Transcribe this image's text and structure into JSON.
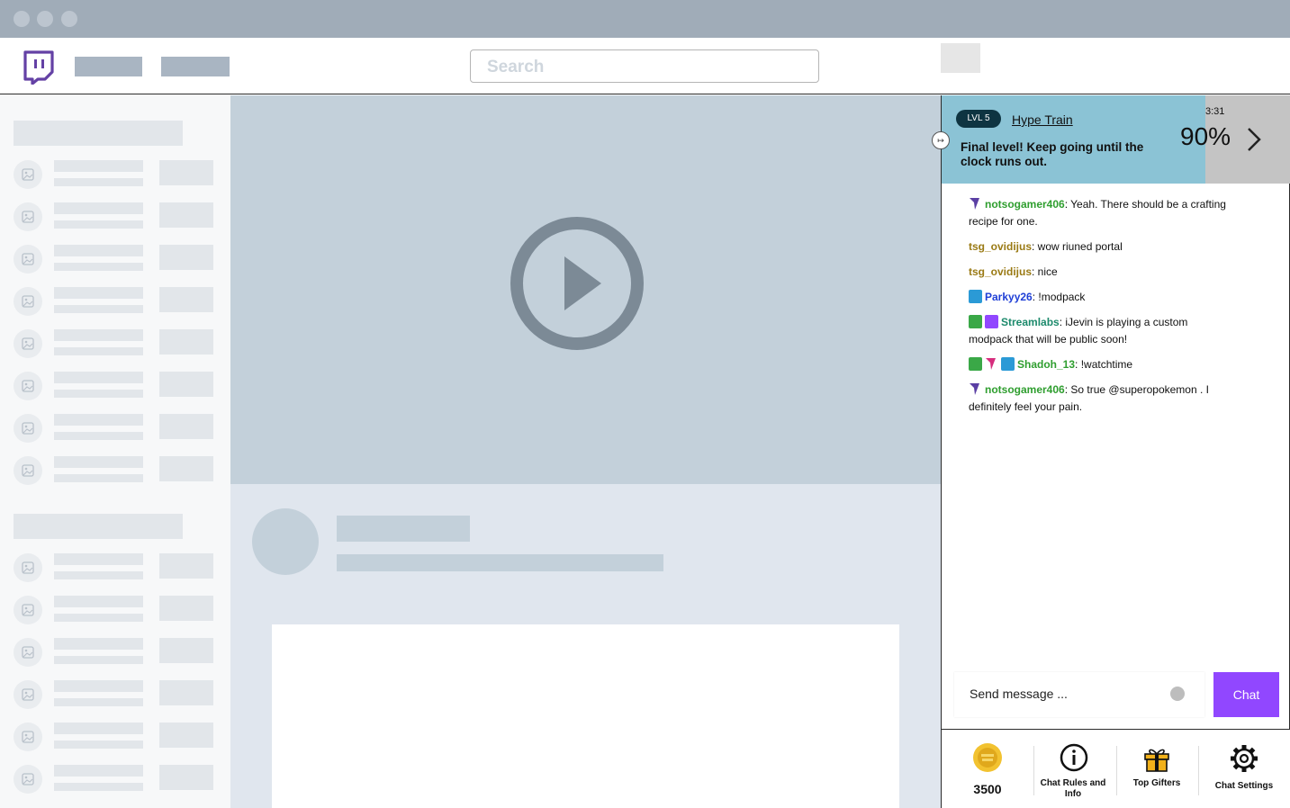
{
  "search": {
    "placeholder": "Search"
  },
  "hype_train": {
    "level": "LVL 5",
    "title": "Hype Train",
    "description": "Final level! Keep going until the clock runs out.",
    "timer": "3:31",
    "progress": "90%"
  },
  "chat": {
    "messages": [
      {
        "badges": [
          "prime"
        ],
        "user": "notsogamer406",
        "color": "#2f9e2f",
        "text": ": Yeah. There should be a crafting recipe for one."
      },
      {
        "badges": [],
        "user": "tsg_ovidijus",
        "color": "#9a7a14",
        "text": ": wow riuned portal"
      },
      {
        "badges": [],
        "user": "tsg_ovidijus",
        "color": "#9a7a14",
        "text": ": nice"
      },
      {
        "badges": [
          "crown"
        ],
        "user": "Parkyy26",
        "color": "#1f3fd6",
        "text": ": !modpack"
      },
      {
        "badges": [
          "sword",
          "verified"
        ],
        "user": "Streamlabs",
        "color": "#1d8a6c",
        "text": ": iJevin is playing a custom modpack that will be public soon!"
      },
      {
        "badges": [
          "sword",
          "prime-pink",
          "crown"
        ],
        "user": "Shadoh_13",
        "color": "#2f9e2f",
        "text": ": !watchtime"
      },
      {
        "badges": [
          "prime"
        ],
        "user": "notsogamer406",
        "color": "#2f9e2f",
        "text": ": So true @superopokemon . I definitely feel your pain."
      }
    ],
    "input_placeholder": "Send message ...",
    "send_label": "Chat"
  },
  "bottom_bar": {
    "coins": "3500",
    "rules": "Chat Rules and Info",
    "gifters": "Top Gifters",
    "settings": "Chat Settings"
  }
}
